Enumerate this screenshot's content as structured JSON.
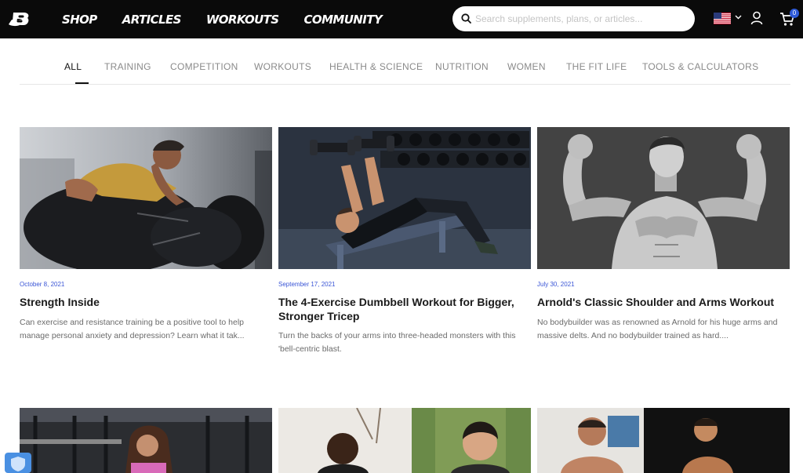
{
  "nav": {
    "items": [
      "SHOP",
      "ARTICLES",
      "WORKOUTS",
      "COMMUNITY"
    ],
    "search_placeholder": "Search supplements, plans, or articles...",
    "cart_count": "0"
  },
  "categories": {
    "tabs": [
      "ALL",
      "TRAINING",
      "COMPETITION",
      "WORKOUTS",
      "HEALTH & SCIENCE",
      "NUTRITION",
      "WOMEN",
      "THE FIT LIFE",
      "TOOLS & CALCULATORS"
    ],
    "active": "ALL"
  },
  "articles": [
    {
      "date": "October 8, 2021",
      "title": "Strength Inside",
      "description": "Can exercise and resistance training be a positive tool to help manage personal anxiety and depression? Learn what it tak..."
    },
    {
      "date": "September 17, 2021",
      "title": "The 4-Exercise Dumbbell Workout for Bigger, Stronger Tricep",
      "description": "Turn the backs of your arms into three-headed monsters with this 'bell-centric blast."
    },
    {
      "date": "July 30, 2021",
      "title": "Arnold's Classic Shoulder and Arms Workout",
      "description": "No bodybuilder was as renowned as Arnold for his huge arms and massive delts. And no bodybuilder trained as hard...."
    }
  ],
  "colors": {
    "header_bg": "#0a0a0a",
    "date_link": "#3a55d6",
    "cart_badge": "#2f5bd8"
  },
  "icons": [
    "bodybuilding-logo-icon",
    "search-icon",
    "us-flag-icon",
    "chevron-down-icon",
    "user-icon",
    "cart-icon",
    "shield-icon"
  ]
}
